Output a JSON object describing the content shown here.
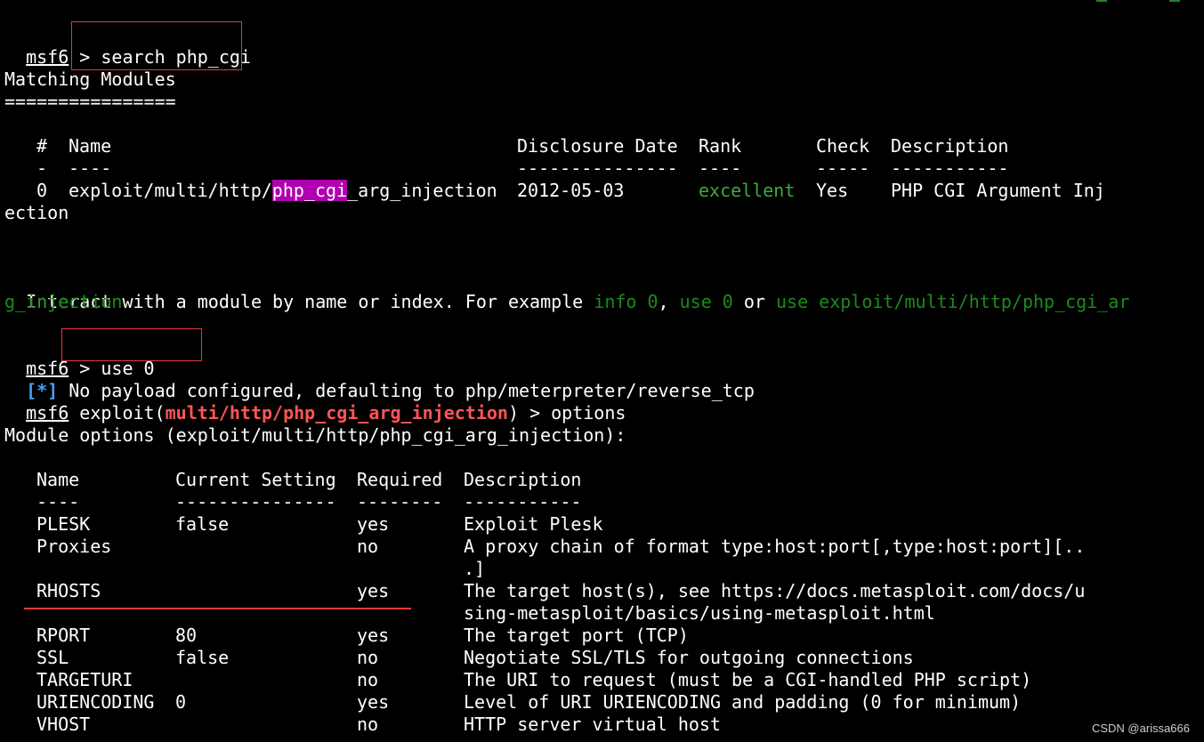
{
  "prompt": "msf6",
  "prompt_sep": " > ",
  "cmd_search": "search php_cgi",
  "matching_header": "Matching Modules",
  "matching_rule": "================",
  "modules_table": {
    "headers": [
      "#",
      "Name",
      "Disclosure Date",
      "Rank",
      "Check",
      "Description"
    ],
    "dashes": [
      "-",
      "----",
      "---------------",
      "----",
      "-----",
      "-----------"
    ],
    "row": {
      "index": "0",
      "name_prefix": "exploit/multi/http/",
      "name_highlight": "php_cgi",
      "name_suffix": "_arg_injection",
      "date": "2012-05-03",
      "rank": "excellent",
      "check": "Yes",
      "description_line1": "PHP CGI Argument Inj",
      "description_line2": "ection"
    }
  },
  "interact": {
    "text1": "Interact with a module by name or index. For example ",
    "ex1": "info 0",
    "sep1": ", ",
    "ex2": "use 0",
    "sep2": " or ",
    "ex3_part1": "use exploit/multi/http/php_cgi_ar",
    "ex3_part2": "g_injection"
  },
  "cmd_use": "use 0",
  "info_marker": "[*]",
  "info_text": " No payload configured, defaulting to php/meterpreter/reverse_tcp",
  "exploit_prompt": {
    "word": " exploit(",
    "module": "multi/http/php_cgi_arg_injection",
    "close": ") > ",
    "command": "options"
  },
  "module_options_title": "Module options (exploit/multi/http/php_cgi_arg_injection):",
  "options_table": {
    "headers": [
      "Name",
      "Current Setting",
      "Required",
      "Description"
    ],
    "dashes": [
      "----",
      "---------------",
      "--------",
      "-----------"
    ],
    "rows": [
      {
        "name": "PLESK",
        "setting": "false",
        "required": "yes",
        "desc": [
          "Exploit Plesk"
        ]
      },
      {
        "name": "Proxies",
        "setting": "",
        "required": "no",
        "desc": [
          "A proxy chain of format type:host:port[,type:host:port][..",
          ".]"
        ]
      },
      {
        "name": "RHOSTS",
        "setting": "",
        "required": "yes",
        "desc": [
          "The target host(s), see https://docs.metasploit.com/docs/u",
          "sing-metasploit/basics/using-metasploit.html"
        ]
      },
      {
        "name": "RPORT",
        "setting": "80",
        "required": "yes",
        "desc": [
          "The target port (TCP)"
        ]
      },
      {
        "name": "SSL",
        "setting": "false",
        "required": "no",
        "desc": [
          "Negotiate SSL/TLS for outgoing connections"
        ]
      },
      {
        "name": "TARGETURI",
        "setting": "",
        "required": "no",
        "desc": [
          "The URI to request (must be a CGI-handled PHP script)"
        ]
      },
      {
        "name": "URIENCODING",
        "setting": "0",
        "required": "yes",
        "desc": [
          "Level of URI URIENCODING and padding (0 for minimum)"
        ]
      },
      {
        "name": "VHOST",
        "setting": "",
        "required": "no",
        "desc": [
          "HTTP server virtual host"
        ]
      }
    ]
  },
  "watermark": "CSDN @arissa666",
  "colors": {
    "background": "#000000",
    "text": "#ffffff",
    "rank_green": "#3fa93f",
    "example_green": "#1e8a1e",
    "module_red": "#ff5555",
    "info_blue": "#4aa0f0",
    "highlight_magenta": "#b000b0",
    "annotation_red": "#e53935"
  }
}
